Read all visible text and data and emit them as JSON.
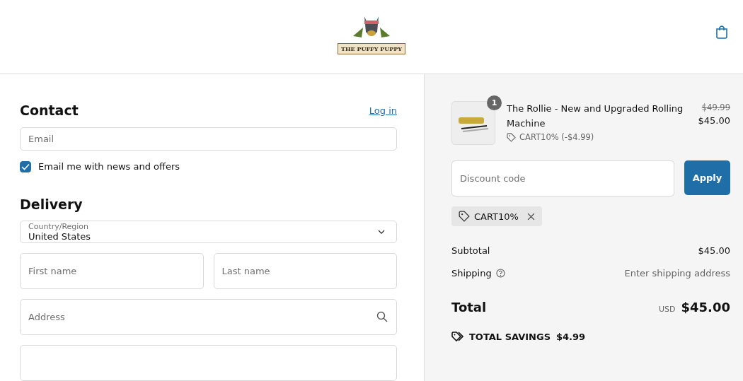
{
  "header": {
    "logo_text": "THE PUFFY PUPPY"
  },
  "contact": {
    "heading": "Contact",
    "login_link": "Log in",
    "email_placeholder": "Email",
    "newsletter": {
      "label": "Email me with news and offers",
      "checked": true
    }
  },
  "delivery": {
    "heading": "Delivery",
    "country": {
      "label": "Country/Region",
      "value": "United States"
    },
    "first_name_placeholder": "First name",
    "last_name_placeholder": "Last name",
    "address_placeholder": "Address"
  },
  "order": {
    "item": {
      "quantity": "1",
      "name": "The Rollie - New and Upgraded Rolling Machine",
      "discount": "CART10% (-$4.99)",
      "original_price": "$49.99",
      "price": "$45.00"
    },
    "discount_placeholder": "Discount code",
    "apply_button": "Apply",
    "applied_code": "CART10%",
    "subtotal_label": "Subtotal",
    "subtotal_value": "$45.00",
    "shipping_label": "Shipping",
    "shipping_value": "Enter shipping address",
    "total_label": "Total",
    "total_currency": "USD",
    "total_value": "$45.00",
    "savings_label": "TOTAL SAVINGS",
    "savings_value": "$4.99"
  }
}
